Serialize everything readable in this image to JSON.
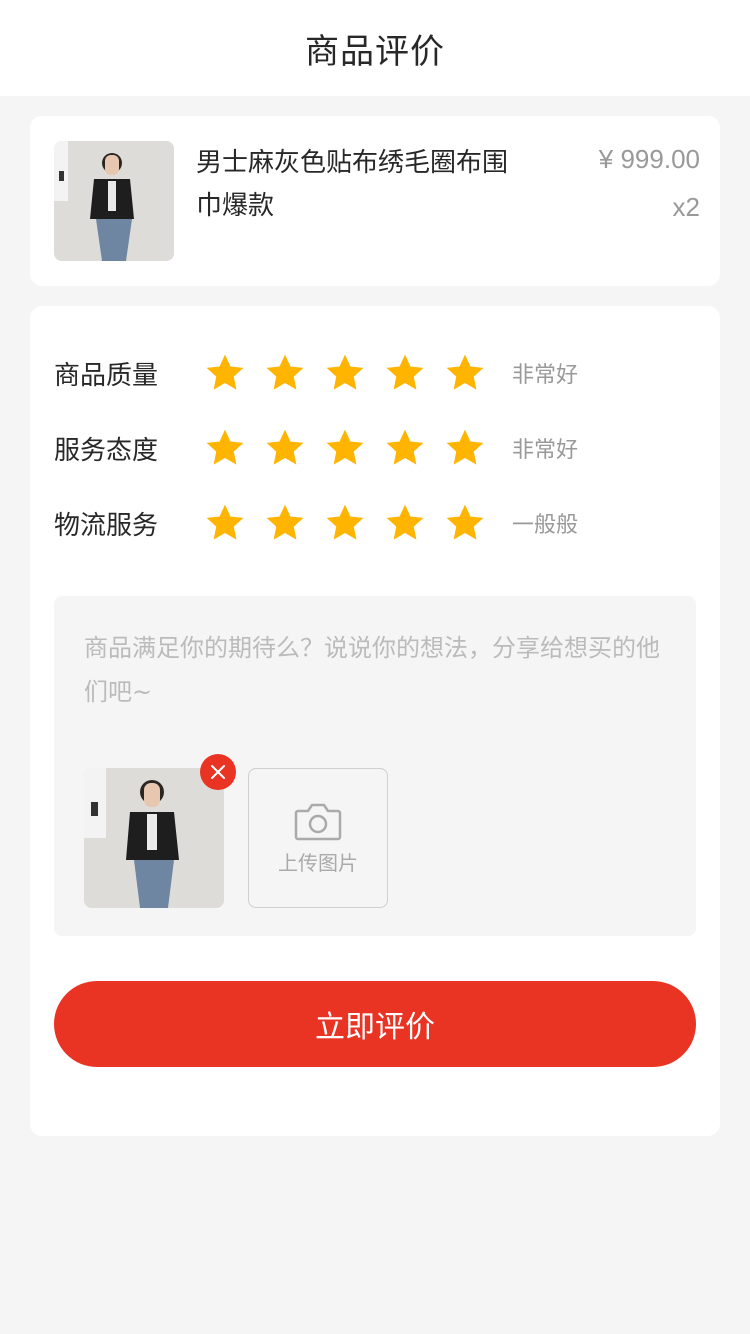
{
  "nav": {
    "title": "商品评价"
  },
  "product": {
    "name": "男士麻灰色贴布绣毛圈布围巾爆款",
    "price": "¥ 999.00",
    "quantity": "x2",
    "image_icon": "product-photo"
  },
  "ratings": [
    {
      "label": "商品质量",
      "score": 5,
      "max": 5,
      "text": "非常好"
    },
    {
      "label": "服务态度",
      "score": 5,
      "max": 5,
      "text": "非常好"
    },
    {
      "label": "物流服务",
      "score": 5,
      "max": 5,
      "text": "一般般"
    }
  ],
  "comment": {
    "placeholder": "商品满足你的期待么？说说你的想法，分享给想买的他们吧~",
    "value": ""
  },
  "upload": {
    "label": "上传图片",
    "icon": "camera-icon",
    "delete_icon": "close-icon"
  },
  "submit": {
    "label": "立即评价"
  },
  "colors": {
    "accent": "#e93323",
    "star": "#ffb400",
    "background": "#f5f5f5"
  }
}
